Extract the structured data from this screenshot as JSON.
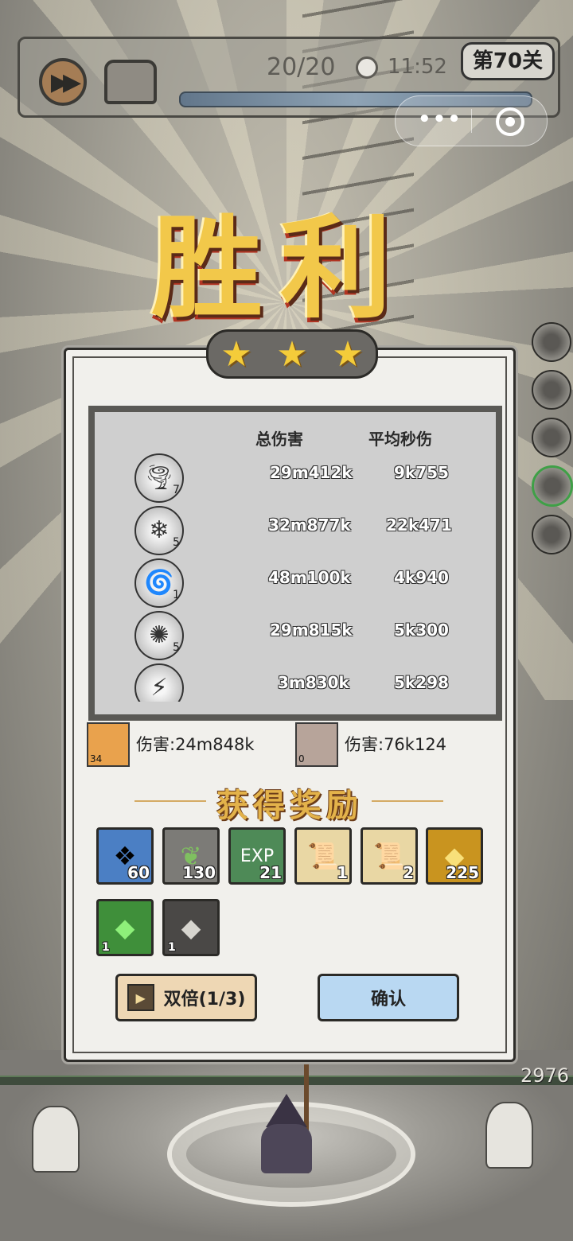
{
  "hud": {
    "wave": "20/20",
    "time": "11:52",
    "level": "第70关",
    "fast_forward_icon": "fast-forward-icon",
    "chest_icon": "chest-icon",
    "menu_dots": "•••",
    "hp_fraction": 1.0
  },
  "victory_title": "胜利",
  "stars": [
    "★",
    "★",
    "★"
  ],
  "stats": {
    "header_total": "总伤害",
    "header_avg": "平均秒伤",
    "rows": [
      {
        "icon": "tornado-icon",
        "glyph": "🌪",
        "level": "7",
        "total": "29m412k",
        "avg": "9k755"
      },
      {
        "icon": "crystal-icon",
        "glyph": "❄",
        "level": "5",
        "total": "32m877k",
        "avg": "22k471"
      },
      {
        "icon": "whirlwind-icon",
        "glyph": "🌀",
        "level": "1",
        "total": "48m100k",
        "avg": "4k940"
      },
      {
        "icon": "blackhole-icon",
        "glyph": "✺",
        "level": "5",
        "total": "29m815k",
        "avg": "5k300"
      },
      {
        "icon": "lightning-icon",
        "glyph": "⚡",
        "level": "",
        "total": "3m830k",
        "avg": "5k298"
      }
    ]
  },
  "heroes": [
    {
      "level": "34",
      "label": "伤害:24m848k",
      "color": "#e9a24d"
    },
    {
      "level": "0",
      "label": "伤害:76k124",
      "color": "#b7a49a"
    }
  ],
  "reward_title": "获得奖励",
  "rewards": [
    {
      "icon": "ice-crystal-icon",
      "glyph": "❖",
      "count": "60",
      "bg": "#4b7fc4"
    },
    {
      "icon": "plant-emblem-icon",
      "glyph": "❦",
      "count": "130",
      "bg": "#7c7b77"
    },
    {
      "icon": "exp-orb-icon",
      "glyph": "EXP",
      "count": "21",
      "bg": "#4e8a57"
    },
    {
      "icon": "scroll-icon",
      "glyph": "📜",
      "count": "1",
      "bg": "#e9d7a4"
    },
    {
      "icon": "recipe-scroll-icon",
      "glyph": "📜",
      "count": "2",
      "bg": "#e9d7a4"
    },
    {
      "icon": "gold-coin-icon",
      "glyph": "◆",
      "count": "225",
      "bg": "#c9941f"
    },
    {
      "icon": "green-gem-icon",
      "glyph": "◆",
      "count": "1",
      "bg": "#3f8f3a"
    },
    {
      "icon": "stone-ore-icon",
      "glyph": "◆",
      "count": "1",
      "bg": "#8a8884"
    }
  ],
  "buttons": {
    "double": "双倍(1/3)",
    "confirm": "确认"
  },
  "score": "2976"
}
